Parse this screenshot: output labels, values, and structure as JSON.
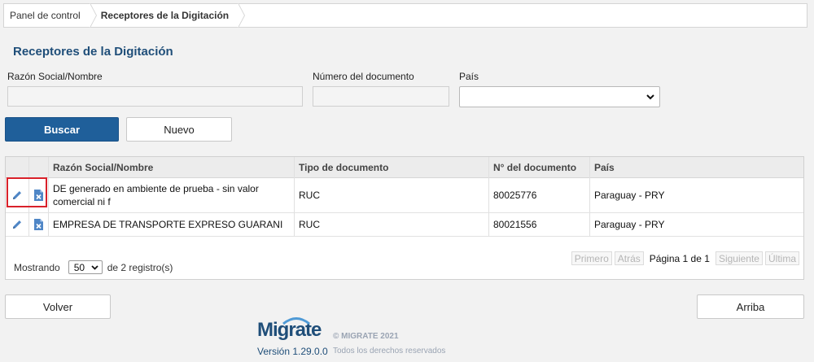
{
  "breadcrumb": {
    "items": [
      {
        "label": "Panel de control"
      },
      {
        "label": "Receptores de la Digitación"
      }
    ]
  },
  "page": {
    "title": "Receptores de la Digitación"
  },
  "filters": {
    "razon_label": "Razón Social/Nombre",
    "razon_value": "",
    "numero_label": "Número del documento",
    "numero_value": "",
    "pais_label": "País",
    "pais_value": ""
  },
  "actions": {
    "buscar": "Buscar",
    "nuevo": "Nuevo"
  },
  "table": {
    "columns": [
      "Razón Social/Nombre",
      "Tipo de documento",
      "N° del documento",
      "País"
    ],
    "rows": [
      {
        "razon": "DE generado en ambiente de prueba - sin valor comercial ni f",
        "tipo": "RUC",
        "numero": "80025776",
        "pais": "Paraguay - PRY"
      },
      {
        "razon": "EMPRESA DE TRANSPORTE EXPRESO GUARANI",
        "tipo": "RUC",
        "numero": "80021556",
        "pais": "Paraguay - PRY"
      }
    ],
    "row_icons": [
      "pencil-edit-icon",
      "delete-file-icon"
    ]
  },
  "footer": {
    "mostrando": "Mostrando",
    "page_size": "50",
    "count_text": "de 2 registro(s)",
    "primero": "Primero",
    "atras": "Atrás",
    "pagina_label": "Página",
    "current_page": "1",
    "de": "de",
    "total_pages": "1",
    "siguiente": "Siguiente",
    "ultima": "Última"
  },
  "bottom": {
    "volver": "Volver",
    "arriba": "Arriba"
  },
  "brand": {
    "name": "Migrate",
    "version": "Versión  1.29.0.0",
    "copyright": "© MIGRATE 2021",
    "rights": "Todos los derechos reservados"
  },
  "colors": {
    "accent": "#1f5f9a",
    "title": "#1f4e79",
    "highlight": "#d9212a",
    "icon": "#4f86c6"
  }
}
